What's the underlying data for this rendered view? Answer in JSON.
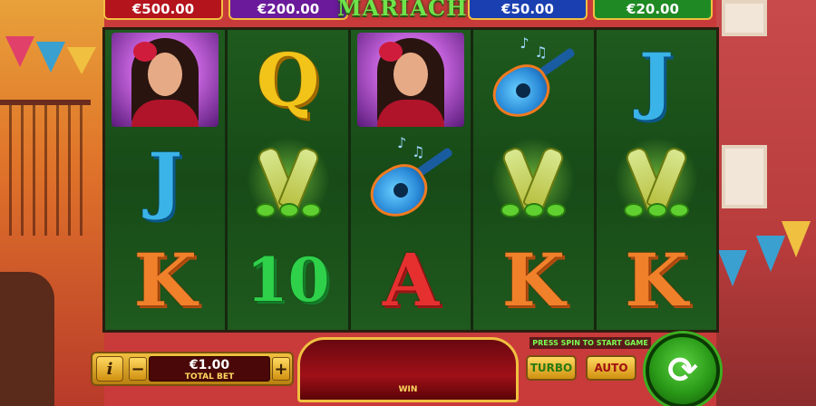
{
  "jackpots": [
    {
      "label": "€500.00",
      "color": "#b4141c"
    },
    {
      "label": "€200.00",
      "color": "#6a1a9a"
    },
    {
      "label": "€50.00",
      "color": "#1a3fb0"
    },
    {
      "label": "€20.00",
      "color": "#1f8a24"
    }
  ],
  "logo": {
    "text": "MARIACHI"
  },
  "reels": [
    [
      "woman",
      "J",
      "K"
    ],
    [
      "Q",
      "bottles",
      "10"
    ],
    [
      "woman",
      "guitar",
      "A"
    ],
    [
      "guitar",
      "bottles",
      "K"
    ],
    [
      "J",
      "bottles",
      "K"
    ]
  ],
  "controls": {
    "info_label": "i",
    "minus_label": "−",
    "plus_label": "+",
    "bet_amount": "€1.00",
    "bet_label": "TOTAL BET",
    "win_label": "WIN",
    "hint": "PRESS SPIN TO START GAME",
    "turbo_label": "TURBO",
    "auto_label": "AUTO",
    "spin_icon": "refresh-icon"
  }
}
